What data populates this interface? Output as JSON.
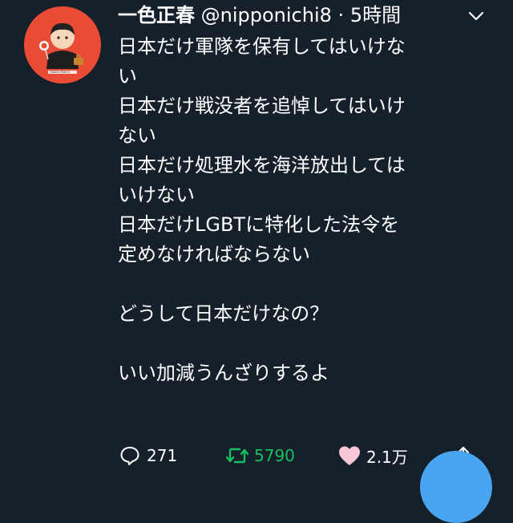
{
  "tweet": {
    "display_name": "一色正春",
    "handle": "@nipponichi8",
    "separator": "·",
    "time": "5時間",
    "lines": [
      "日本だけ軍隊を保有してはいけな",
      "い",
      "日本だけ戦没者を追悼してはいけ",
      "ない",
      "日本だけ処理水を海洋放出しては",
      "いけない",
      "日本だけLGBTに特化した法令を",
      "定めなければならない",
      "",
      "どうして日本だけなの？",
      "",
      "いい加減うんざりするよ"
    ]
  },
  "avatar": {
    "caption": "masa-chan's",
    "background": "#e94b35"
  },
  "actions": {
    "reply_count": "271",
    "retweet_count": "5790",
    "like_count": "2.1万"
  },
  "colors": {
    "background": "#15202b",
    "retweet": "#17bf63",
    "like": "#f7c6d8",
    "accent": "#4aa5f0"
  },
  "icons": {
    "reply": "speech-bubble-icon",
    "retweet": "retweet-icon",
    "like": "heart-icon",
    "share": "share-icon",
    "menu": "chevron-down-icon"
  }
}
